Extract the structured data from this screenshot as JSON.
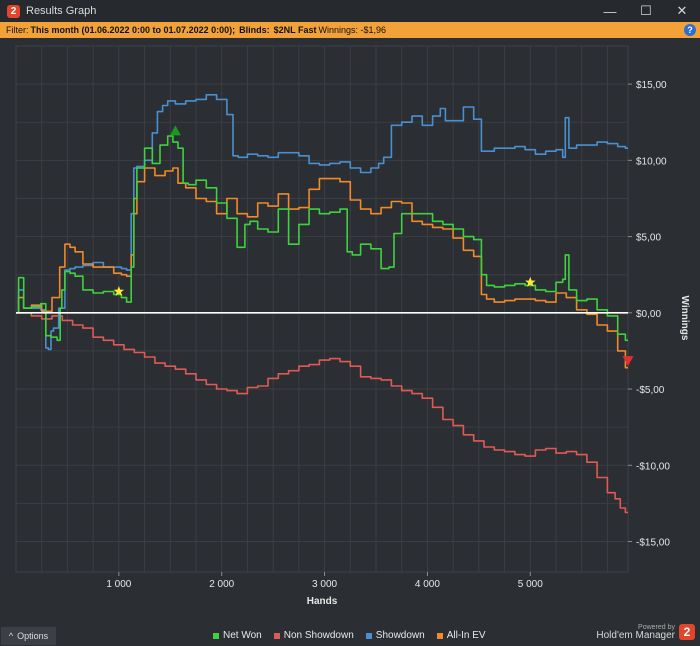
{
  "window": {
    "badge": "2",
    "title": "Results Graph",
    "minimize": "—",
    "maximize": "☐",
    "close": "✕"
  },
  "filter": {
    "prefix": "Filter:",
    "range": "This month (01.06.2022 0:00 to 01.07.2022 0:00);",
    "blinds_label": "Blinds:",
    "blinds_value": "$2NL Fast",
    "winnings": "Winnings: -$1,96",
    "help": "?"
  },
  "footer": {
    "options": "Options",
    "options_icon": "^",
    "powered_by": "Powered by",
    "brand": "Hold'em Manager",
    "brand_badge": "2"
  },
  "colors": {
    "net_won": "#3ed23e",
    "non_showdown": "#e05a55",
    "showdown": "#4a90d0",
    "all_in_ev": "#f08a2a",
    "zero_line": "#ffffff",
    "grid": "#3b3f45",
    "plot_bg": "#2b2e33"
  },
  "chart_data": {
    "type": "line",
    "xlabel": "Hands",
    "ylabel": "Winnings",
    "xlim": [
      0,
      5950
    ],
    "ylim": [
      -17,
      17.5
    ],
    "x_ticks": [
      1000,
      2000,
      3000,
      4000,
      5000
    ],
    "x_tick_labels": [
      "1 000",
      "2 000",
      "3 000",
      "4 000",
      "5 000"
    ],
    "y_ticks": [
      15,
      10,
      5,
      0,
      -5,
      -10,
      -15
    ],
    "y_tick_labels": [
      "$15,00",
      "$10,00",
      "$5,00",
      "$0,00",
      "-$5,00",
      "-$10,00",
      "-$15,00"
    ],
    "grid": true,
    "legend_position": "bottom",
    "series": [
      {
        "name": "Net Won",
        "x": [
          0,
          50,
          100,
          200,
          280,
          300,
          380,
          420,
          440,
          450,
          500,
          550,
          600,
          700,
          800,
          900,
          1000,
          1050,
          1100,
          1140,
          1150,
          1200,
          1300,
          1350,
          1450,
          1500,
          1550,
          1600,
          1650,
          1700,
          1800,
          1900,
          2000,
          2100,
          2200,
          2250,
          2300,
          2400,
          2500,
          2600,
          2700,
          2800,
          2900,
          3000,
          3100,
          3200,
          3240,
          3300,
          3400,
          3500,
          3600,
          3650,
          3700,
          3800,
          3900,
          4000,
          4100,
          4200,
          4300,
          4400,
          4500,
          4550,
          4600,
          4700,
          4800,
          4900,
          5000,
          5100,
          5200,
          5300,
          5330,
          5350,
          5400,
          5500,
          5600,
          5700,
          5800,
          5900,
          5950
        ],
        "y": [
          0,
          2.3,
          0.3,
          0.4,
          0.6,
          -1.5,
          -1.6,
          -1.8,
          0.3,
          1.5,
          2.7,
          2.6,
          2.4,
          1.5,
          1.3,
          1.4,
          1.2,
          1.0,
          0.7,
          3.0,
          7.5,
          9.5,
          10.8,
          9.8,
          11.0,
          11.6,
          11.2,
          10.8,
          8.5,
          8.4,
          8.7,
          8.2,
          7.2,
          6.2,
          4.3,
          5.8,
          6.0,
          5.5,
          5.3,
          6.8,
          4.5,
          5.8,
          6.8,
          6.5,
          6.6,
          6.8,
          4.0,
          3.8,
          4.5,
          4.2,
          2.9,
          3.0,
          5.2,
          6.5,
          6.5,
          6.5,
          6.0,
          5.8,
          5.5,
          5.0,
          4.8,
          2.5,
          1.8,
          1.7,
          1.8,
          1.9,
          1.8,
          1.5,
          1.4,
          2.0,
          2.2,
          3.8,
          1.5,
          0.8,
          0.9,
          0.2,
          -0.2,
          -1.4,
          -1.8
        ]
      },
      {
        "name": "Non Showdown",
        "x": [
          0,
          100,
          200,
          300,
          400,
          500,
          600,
          700,
          800,
          900,
          1000,
          1100,
          1200,
          1300,
          1400,
          1500,
          1600,
          1700,
          1800,
          1900,
          2000,
          2100,
          2200,
          2300,
          2400,
          2500,
          2600,
          2700,
          2800,
          2900,
          3000,
          3100,
          3200,
          3300,
          3400,
          3500,
          3600,
          3700,
          3800,
          3900,
          4000,
          4100,
          4200,
          4300,
          4400,
          4500,
          4600,
          4700,
          4800,
          4900,
          5000,
          5100,
          5200,
          5300,
          5400,
          5500,
          5600,
          5700,
          5800,
          5850,
          5900,
          5950
        ],
        "y": [
          0,
          0,
          -0.2,
          -0.4,
          -0.2,
          -0.5,
          -0.8,
          -1.0,
          -1.6,
          -1.8,
          -2.1,
          -2.4,
          -2.6,
          -2.9,
          -3.3,
          -3.5,
          -3.7,
          -4.0,
          -4.4,
          -4.7,
          -5.0,
          -5.1,
          -5.3,
          -4.9,
          -4.8,
          -4.3,
          -4.0,
          -3.8,
          -3.5,
          -3.4,
          -3.1,
          -3.0,
          -3.2,
          -3.5,
          -4.2,
          -4.3,
          -4.4,
          -4.8,
          -5.1,
          -5.3,
          -5.6,
          -6.2,
          -7.0,
          -7.4,
          -8.0,
          -8.4,
          -8.8,
          -9.0,
          -9.1,
          -9.3,
          -9.4,
          -9.0,
          -8.9,
          -9.2,
          -9.1,
          -9.3,
          -9.8,
          -10.8,
          -11.8,
          -12.2,
          -12.8,
          -13.1
        ]
      },
      {
        "name": "Showdown",
        "x": [
          0,
          50,
          100,
          200,
          280,
          300,
          330,
          350,
          380,
          450,
          500,
          550,
          600,
          700,
          800,
          900,
          1000,
          1050,
          1100,
          1140,
          1150,
          1200,
          1300,
          1350,
          1400,
          1450,
          1500,
          1600,
          1700,
          1800,
          1900,
          2000,
          2100,
          2120,
          2200,
          2300,
          2400,
          2500,
          2600,
          2700,
          2800,
          2900,
          3000,
          3100,
          3200,
          3300,
          3400,
          3500,
          3550,
          3600,
          3700,
          3800,
          3900,
          4000,
          4100,
          4150,
          4200,
          4300,
          4400,
          4500,
          4550,
          4600,
          4700,
          4800,
          4900,
          5000,
          5100,
          5200,
          5300,
          5330,
          5350,
          5400,
          5500,
          5600,
          5700,
          5800,
          5900,
          5950
        ],
        "y": [
          0,
          1.5,
          0.3,
          0.3,
          0.2,
          -2.3,
          -2.4,
          -1.2,
          -1.0,
          0.3,
          2.8,
          2.9,
          3.0,
          3.1,
          3.3,
          3.0,
          3.0,
          2.9,
          2.8,
          6.5,
          9.5,
          9.6,
          10.0,
          11.8,
          13.2,
          13.6,
          13.9,
          13.7,
          13.9,
          14.0,
          14.3,
          14.0,
          13.0,
          10.3,
          10.2,
          10.4,
          10.3,
          10.2,
          10.5,
          10.5,
          10.3,
          9.8,
          9.7,
          9.8,
          9.9,
          9.5,
          9.2,
          9.5,
          9.8,
          10.2,
          12.3,
          12.5,
          12.9,
          12.3,
          12.9,
          13.4,
          12.6,
          12.6,
          13.5,
          12.7,
          10.6,
          10.6,
          10.8,
          10.8,
          10.9,
          10.7,
          10.4,
          10.6,
          10.7,
          10.2,
          12.8,
          10.8,
          11.0,
          11.0,
          11.2,
          11.1,
          10.9,
          10.8
        ]
      },
      {
        "name": "All-In EV",
        "x": [
          0,
          50,
          100,
          200,
          300,
          400,
          450,
          500,
          550,
          600,
          700,
          800,
          900,
          1000,
          1050,
          1100,
          1140,
          1150,
          1200,
          1300,
          1400,
          1500,
          1550,
          1600,
          1700,
          1800,
          1900,
          2000,
          2100,
          2200,
          2300,
          2400,
          2500,
          2600,
          2700,
          2800,
          2900,
          3000,
          3100,
          3200,
          3300,
          3400,
          3500,
          3600,
          3700,
          3800,
          3900,
          4000,
          4100,
          4200,
          4300,
          4400,
          4500,
          4550,
          4600,
          4700,
          4800,
          4900,
          5000,
          5100,
          5200,
          5300,
          5400,
          5500,
          5600,
          5700,
          5800,
          5900,
          5950
        ],
        "y": [
          0,
          1.0,
          0.3,
          0.5,
          0.1,
          1.0,
          3.0,
          4.5,
          4.3,
          4.0,
          3.2,
          3.0,
          3.0,
          2.6,
          2.5,
          2.4,
          3.8,
          6.5,
          8.6,
          9.5,
          9.0,
          9.3,
          9.5,
          8.5,
          8.2,
          7.5,
          7.3,
          6.5,
          7.5,
          6.5,
          6.3,
          7.2,
          7.0,
          7.8,
          6.8,
          6.9,
          8.1,
          8.8,
          8.8,
          8.6,
          7.4,
          6.8,
          6.5,
          6.9,
          7.3,
          7.2,
          6.0,
          5.8,
          5.6,
          5.5,
          4.9,
          4.1,
          3.7,
          1.2,
          0.9,
          0.7,
          0.8,
          0.9,
          0.9,
          0.8,
          0.7,
          1.3,
          1.0,
          0.2,
          -0.1,
          -0.8,
          -1.2,
          -2.5,
          -3.6
        ]
      }
    ],
    "markers": [
      {
        "symbol": "star",
        "color": "#ffe83a",
        "x": 1000,
        "y": 1.4
      },
      {
        "symbol": "star",
        "color": "#ffe83a",
        "x": 5000,
        "y": 2.0
      },
      {
        "symbol": "triangle-up",
        "color": "#1a9a1a",
        "x": 1550,
        "y": 11.9
      },
      {
        "symbol": "triangle-down",
        "color": "#e03030",
        "x": 5950,
        "y": -3.1
      }
    ]
  }
}
